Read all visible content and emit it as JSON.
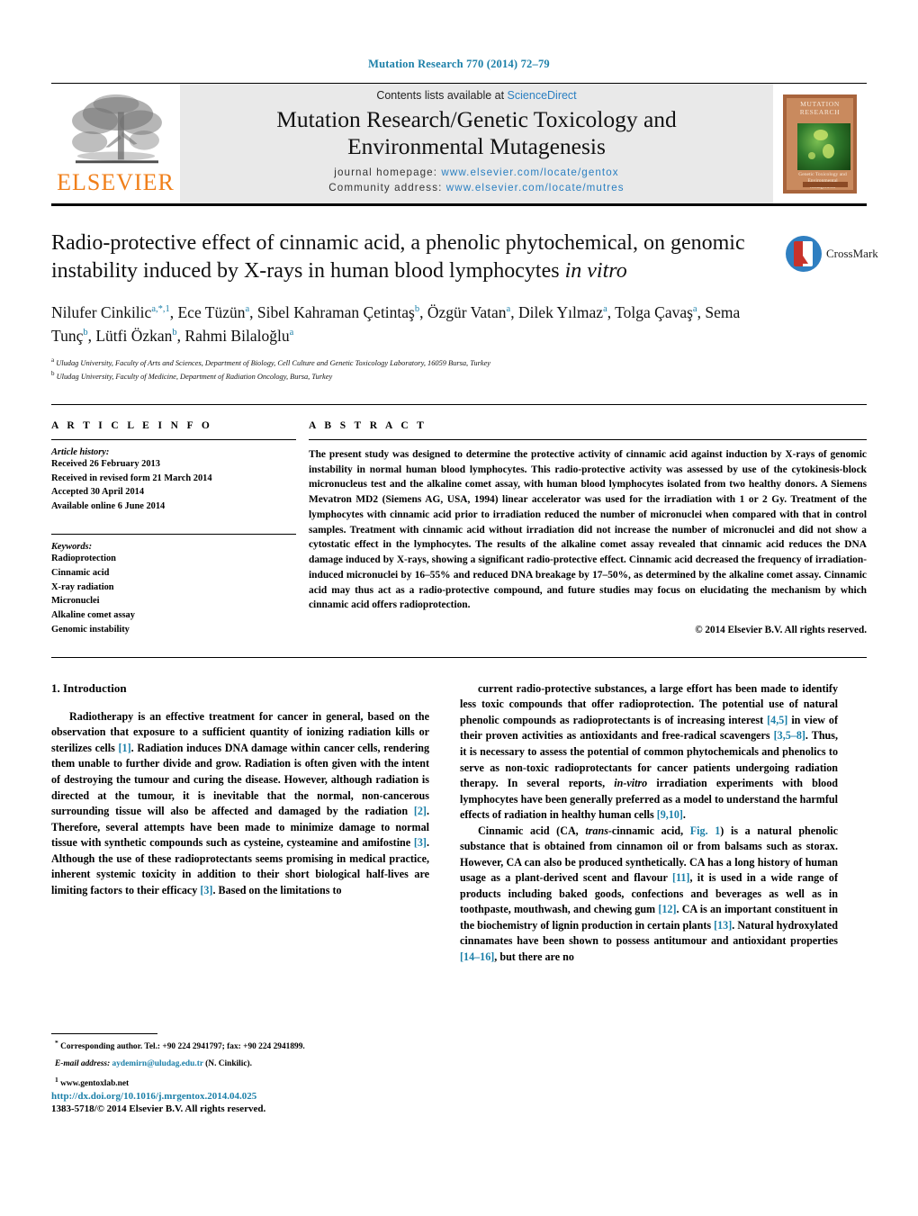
{
  "running_head": "Mutation Research 770 (2014) 72–79",
  "masthead": {
    "contents_prefix": "Contents lists available at ",
    "sciencedirect": "ScienceDirect",
    "journal_title_line1": "Mutation Research/Genetic Toxicology and",
    "journal_title_line2": "Environmental Mutagenesis",
    "homepage_label": "journal homepage:",
    "homepage_url": "www.elsevier.com/locate/gentox",
    "community_label": "Community address:",
    "community_url": "www.elsevier.com/locate/mutres",
    "publisher": "ELSEVIER",
    "cover_title_line1": "MUTATION",
    "cover_title_line2": "RESEARCH",
    "cover_sub_line1": "Genetic Toxicology and",
    "cover_sub_line2": "Environmental Mutagenesis"
  },
  "title": {
    "line1": "Radio-protective effect of cinnamic acid, a phenolic phytochemical, on",
    "line2": "genomic instability induced by X-rays in human blood lymphocytes",
    "line3_italic": "in vitro"
  },
  "crossmark_label": "CrossMark",
  "authors_html": "Nilufer Cinkilic<sup>a,*,1</sup>, Ece Tüzün<sup>a</sup>, Sibel Kahraman Çetintaş<sup>b</sup>, Özgür Vatan<sup>a</sup>, Dilek Yılmaz<sup>a</sup>, Tolga Çavaş<sup>a</sup>, Sema Tunç<sup>b</sup>, Lütfi Özkan<sup>b</sup>, Rahmi Bilaloğlu<sup>a</sup>",
  "affiliations": [
    "Uludag University, Faculty of Arts and Sciences, Department of Biology, Cell Culture and Genetic Toxicology Laboratory, 16059 Bursa, Turkey",
    "Uludag University, Faculty of Medicine, Department of Radiation Oncology, Bursa, Turkey"
  ],
  "article_info": {
    "heading": "A R T I C L E   I N F O",
    "history_label": "Article history:",
    "history": [
      "Received 26 February 2013",
      "Received in revised form 21 March 2014",
      "Accepted 30 April 2014",
      "Available online 6 June 2014"
    ],
    "keywords_label": "Keywords:",
    "keywords": [
      "Radioprotection",
      "Cinnamic acid",
      "X-ray radiation",
      "Micronuclei",
      "Alkaline comet assay",
      "Genomic instability"
    ]
  },
  "abstract": {
    "heading": "A B S T R A C T",
    "text": "The present study was designed to determine the protective activity of cinnamic acid against induction by X-rays of genomic instability in normal human blood lymphocytes. This radio-protective activity was assessed by use of the cytokinesis-block micronucleus test and the alkaline comet assay, with human blood lymphocytes isolated from two healthy donors. A Siemens Mevatron MD2 (Siemens AG, USA, 1994) linear accelerator was used for the irradiation with 1 or 2 Gy. Treatment of the lymphocytes with cinnamic acid prior to irradiation reduced the number of micronuclei when compared with that in control samples. Treatment with cinnamic acid without irradiation did not increase the number of micronuclei and did not show a cytostatic effect in the lymphocytes. The results of the alkaline comet assay revealed that cinnamic acid reduces the DNA damage induced by X-rays, showing a significant radio-protective effect. Cinnamic acid decreased the frequency of irradiation-induced micronuclei by 16–55% and reduced DNA breakage by 17–50%, as determined by the alkaline comet assay. Cinnamic acid may thus act as a radio-protective compound, and future studies may focus on elucidating the mechanism by which cinnamic acid offers radioprotection.",
    "copyright": "© 2014 Elsevier B.V. All rights reserved."
  },
  "introduction": {
    "heading": "1.  Introduction",
    "left_paragraph_html": "Radiotherapy is an effective treatment for cancer in general, based on the observation that exposure to a sufficient quantity of ionizing radiation kills or sterilizes cells <span class=\"ref\">[1]</span>. Radiation induces DNA damage within cancer cells, rendering them unable to further divide and grow. Radiation is often given with the intent of destroying the tumour and curing the disease. However, although radiation is directed at the tumour, it is inevitable that the normal, non-cancerous surrounding tissue will also be affected and damaged by the radiation <span class=\"ref\">[2]</span>. Therefore, several attempts have been made to minimize damage to normal tissue with synthetic compounds such as cysteine, cysteamine and amifostine <span class=\"ref\">[3]</span>. Although the use of these radioprotectants seems promising in medical practice, inherent systemic toxicity in addition to their short biological half-lives are limiting factors to their efficacy <span class=\"ref\">[3]</span>. Based on the limitations to",
    "right_paragraph1_html": "current radio-protective substances, a large effort has been made to identify less toxic compounds that offer radioprotection. The potential use of natural phenolic compounds as radioprotectants is of increasing interest <span class=\"ref\">[4,5]</span> in view of their proven activities as antioxidants and free-radical scavengers <span class=\"ref\">[3,5–8]</span>. Thus, it is necessary to assess the potential of common phytochemicals and phenolics to serve as non-toxic radioprotectants for cancer patients undergoing radiation therapy. In several reports, <span class=\"ital\">in-vitro</span> irradiation experiments with blood lymphocytes have been generally preferred as a model to understand the harmful effects of radiation in healthy human cells <span class=\"ref\">[9,10]</span>.",
    "right_paragraph2_html": "Cinnamic acid (CA, <span class=\"ital\">trans</span>-cinnamic acid, <span class=\"ref\">Fig. 1</span>) is a natural phenolic substance that is obtained from cinnamon oil or from balsams such as storax. However, CA can also be produced synthetically. CA has a long history of human usage as a plant-derived scent and flavour <span class=\"ref\">[11]</span>, it is used in a wide range of products including baked goods, confections and beverages as well as in toothpaste, mouthwash, and chewing gum <span class=\"ref\">[12]</span>. CA is an important constituent in the biochemistry of lignin production in certain plants <span class=\"ref\">[13]</span>. Natural hydroxylated cinnamates have been shown to possess antitumour and antioxidant properties <span class=\"ref\">[14–16]</span>, but there are no"
  },
  "footnotes": {
    "corresponding_html": "<sup>*</sup> Corresponding author. Tel.: +90 224 2941797; fax: +90 224 2941899.",
    "email_html": "<span class=\"ital\">E-mail address:</span> <span class=\"mail\">aydemirn@uludag.edu.tr</span> (N. Cinkilic).",
    "website_html": "<sup>1</sup> www.gentoxlab.net"
  },
  "doi": "http://dx.doi.org/10.1016/j.mrgentox.2014.04.025",
  "issn_line": "1383-5718/© 2014 Elsevier B.V. All rights reserved.",
  "colors": {
    "link": "#1b7fa8",
    "elsevier_orange": "#f07f1a",
    "masthead_bg": "#e9e9e9"
  }
}
